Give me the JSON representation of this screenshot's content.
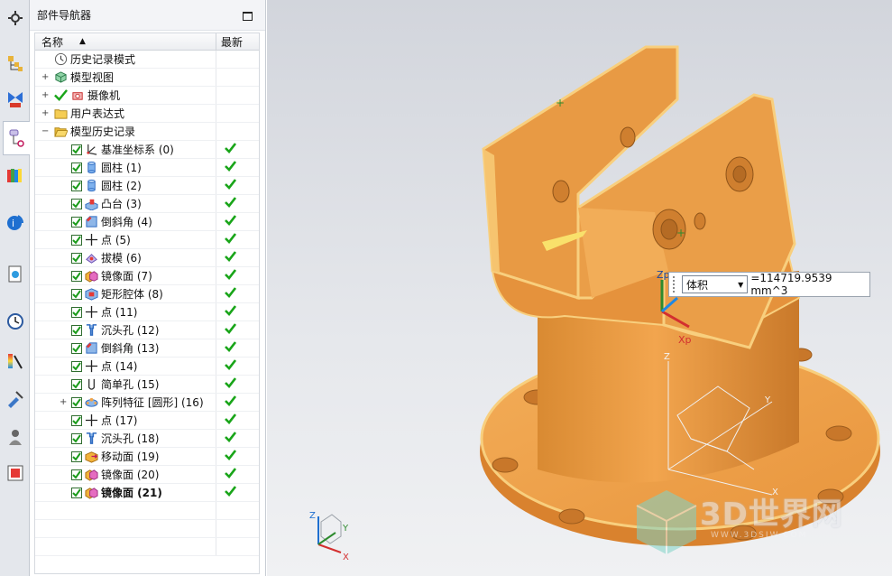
{
  "navigator": {
    "title": "部件导航器",
    "col_name": "名称",
    "col_latest": "最新"
  },
  "tree": [
    {
      "label": "历史记录模式",
      "icon": "clock-icon",
      "level": 0,
      "expander": "",
      "checkbox": false,
      "latest": false,
      "bold": false
    },
    {
      "label": "模型视图",
      "icon": "model-view-icon",
      "level": 0,
      "expander": "+",
      "checkbox": false,
      "latest": false,
      "bold": false
    },
    {
      "label": "摄像机",
      "icon": "camera-icon",
      "level": 0,
      "expander": "+",
      "checkbox": false,
      "tick": true,
      "latest": false,
      "bold": false
    },
    {
      "label": "用户表达式",
      "icon": "folder-icon",
      "level": 0,
      "expander": "+",
      "checkbox": false,
      "latest": false,
      "bold": false
    },
    {
      "label": "模型历史记录",
      "icon": "folder-open-icon",
      "level": 0,
      "expander": "−",
      "checkbox": false,
      "latest": false,
      "bold": false
    },
    {
      "label": "基准坐标系 (0)",
      "icon": "datum-csys-icon",
      "level": 1,
      "expander": "",
      "checkbox": true,
      "latest": true,
      "bold": false
    },
    {
      "label": "圆柱 (1)",
      "icon": "cylinder-icon",
      "level": 1,
      "expander": "",
      "checkbox": true,
      "latest": true,
      "bold": false
    },
    {
      "label": "圆柱 (2)",
      "icon": "cylinder-icon",
      "level": 1,
      "expander": "",
      "checkbox": true,
      "latest": true,
      "bold": false
    },
    {
      "label": "凸台 (3)",
      "icon": "boss-icon",
      "level": 1,
      "expander": "",
      "checkbox": true,
      "latest": true,
      "bold": false
    },
    {
      "label": "倒斜角 (4)",
      "icon": "chamfer-icon",
      "level": 1,
      "expander": "",
      "checkbox": true,
      "latest": true,
      "bold": false
    },
    {
      "label": "点 (5)",
      "icon": "point-icon",
      "level": 1,
      "expander": "",
      "checkbox": true,
      "latest": true,
      "bold": false
    },
    {
      "label": "拔模 (6)",
      "icon": "draft-icon",
      "level": 1,
      "expander": "",
      "checkbox": true,
      "latest": true,
      "bold": false
    },
    {
      "label": "镜像面 (7)",
      "icon": "mirror-face-icon",
      "level": 1,
      "expander": "",
      "checkbox": true,
      "latest": true,
      "bold": false
    },
    {
      "label": "矩形腔体 (8)",
      "icon": "pocket-icon",
      "level": 1,
      "expander": "",
      "checkbox": true,
      "latest": true,
      "bold": false
    },
    {
      "label": "点 (11)",
      "icon": "point-icon",
      "level": 1,
      "expander": "",
      "checkbox": true,
      "latest": true,
      "bold": false
    },
    {
      "label": "沉头孔 (12)",
      "icon": "counterbore-hole-icon",
      "level": 1,
      "expander": "",
      "checkbox": true,
      "latest": true,
      "bold": false
    },
    {
      "label": "倒斜角 (13)",
      "icon": "chamfer-icon",
      "level": 1,
      "expander": "",
      "checkbox": true,
      "latest": true,
      "bold": false
    },
    {
      "label": "点 (14)",
      "icon": "point-icon",
      "level": 1,
      "expander": "",
      "checkbox": true,
      "latest": true,
      "bold": false
    },
    {
      "label": "简单孔 (15)",
      "icon": "simple-hole-icon",
      "level": 1,
      "expander": "",
      "checkbox": true,
      "latest": true,
      "bold": false
    },
    {
      "label": "阵列特征 [圆形] (16)",
      "icon": "pattern-icon",
      "level": 1,
      "expander": "+",
      "checkbox": true,
      "latest": true,
      "bold": false
    },
    {
      "label": "点 (17)",
      "icon": "point-icon",
      "level": 1,
      "expander": "",
      "checkbox": true,
      "latest": true,
      "bold": false
    },
    {
      "label": "沉头孔 (18)",
      "icon": "counterbore-hole-icon",
      "level": 1,
      "expander": "",
      "checkbox": true,
      "latest": true,
      "bold": false
    },
    {
      "label": "移动面 (19)",
      "icon": "move-face-icon",
      "level": 1,
      "expander": "",
      "checkbox": true,
      "latest": true,
      "bold": false
    },
    {
      "label": "镜像面 (20)",
      "icon": "mirror-face-icon",
      "level": 1,
      "expander": "",
      "checkbox": true,
      "latest": true,
      "bold": false
    },
    {
      "label": "镜像面 (21)",
      "icon": "mirror-face-icon",
      "level": 1,
      "expander": "",
      "checkbox": true,
      "latest": true,
      "bold": true
    }
  ],
  "resource_bar": [
    {
      "name": "settings-gear-icon"
    },
    {
      "name": "assembly-navigator-icon"
    },
    {
      "name": "constraint-navigator-icon"
    },
    {
      "name": "part-navigator-icon"
    },
    {
      "name": "reuse-library-icon"
    },
    {
      "name": "web-browser-icon"
    },
    {
      "name": "history-icon"
    },
    {
      "name": "clock-history-icon"
    },
    {
      "name": "system-materials-icon"
    },
    {
      "name": "process-studio-icon"
    },
    {
      "name": "roles-icon"
    },
    {
      "name": "system-scene-icon"
    }
  ],
  "viewport": {
    "measure": {
      "dropdown_value": "体积",
      "result": "=114719.9539 mm^3"
    },
    "csys_labels": {
      "zp": "Zp",
      "xp": "Xp",
      "z": "Z",
      "y": "Y",
      "x": "X"
    },
    "triad_labels": {
      "z": "Z",
      "y": "Y",
      "x": "X"
    },
    "watermark": {
      "text": "3D世界网",
      "url": "WWW.3DSJW.COM"
    },
    "colors": {
      "part": "#f0a24a",
      "part_edge": "#f8cf7e",
      "background_top": "#d2d5dc"
    }
  }
}
